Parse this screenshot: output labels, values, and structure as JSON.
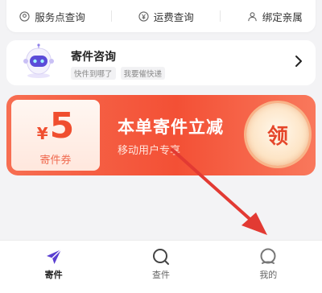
{
  "quick_actions": [
    {
      "label": "服务点查询",
      "icon": "location-pin-icon"
    },
    {
      "label": "运费查询",
      "icon": "yen-coin-icon"
    },
    {
      "label": "绑定亲属",
      "icon": "person-icon"
    }
  ],
  "consult": {
    "title": "寄件咨询",
    "tags": [
      "快件到哪了",
      "我要催快递"
    ]
  },
  "coupon": {
    "currency": "¥",
    "amount": "5",
    "type": "寄件券",
    "title": "本单寄件立减",
    "subtitle": "移动用户专享",
    "claim": "领"
  },
  "tabs": [
    {
      "label": "寄件",
      "icon": "paper-plane-icon",
      "active": true
    },
    {
      "label": "查件",
      "icon": "search-icon",
      "active": false
    },
    {
      "label": "我的",
      "icon": "profile-icon",
      "active": false
    }
  ],
  "colors": {
    "accent": "#f35035",
    "tab_active": "#5b3fd1",
    "arrow": "#e23a33"
  }
}
